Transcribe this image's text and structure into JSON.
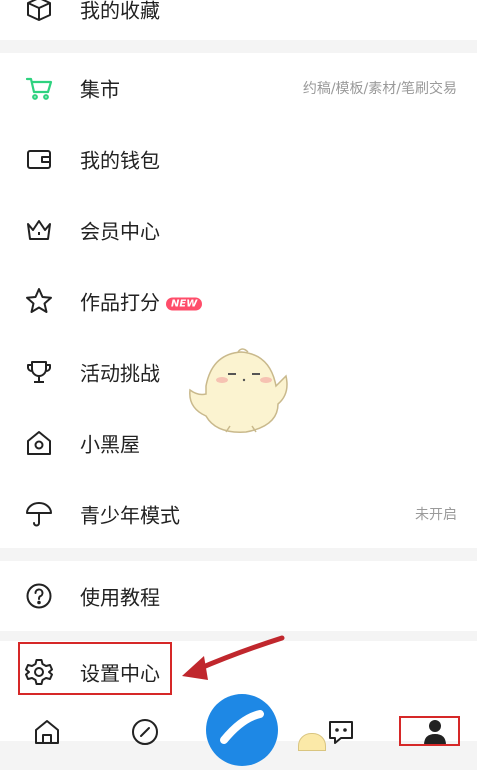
{
  "menu": {
    "favorites": {
      "label": "我的收藏",
      "icon": "box-icon"
    },
    "market": {
      "label": "集市",
      "hint": "约稿/模板/素材/笔刷交易",
      "icon": "cart-icon",
      "icon_color": "#2ed27f"
    },
    "wallet": {
      "label": "我的钱包",
      "icon": "wallet-icon"
    },
    "vip": {
      "label": "会员中心",
      "icon": "crown-icon"
    },
    "rating": {
      "label": "作品打分",
      "badge": "NEW",
      "badge_color": "#ff4d6a",
      "icon": "star-icon"
    },
    "events": {
      "label": "活动挑战",
      "icon": "trophy-icon"
    },
    "blackroom": {
      "label": "小黑屋",
      "icon": "house-icon"
    },
    "youth": {
      "label": "青少年模式",
      "hint": "未开启",
      "icon": "umbrella-icon"
    },
    "tutorial": {
      "label": "使用教程",
      "icon": "help-icon"
    },
    "settings": {
      "label": "设置中心",
      "icon": "gear-icon"
    }
  },
  "tabbar": {
    "tabs": [
      {
        "name": "home",
        "icon": "home-icon"
      },
      {
        "name": "discover",
        "icon": "compass-icon"
      },
      {
        "name": "create",
        "icon": "brush-icon",
        "color": "#1e88e5"
      },
      {
        "name": "messages",
        "icon": "message-icon"
      },
      {
        "name": "profile",
        "icon": "person-icon"
      }
    ]
  },
  "annotation": {
    "highlight_color": "#d62828"
  }
}
